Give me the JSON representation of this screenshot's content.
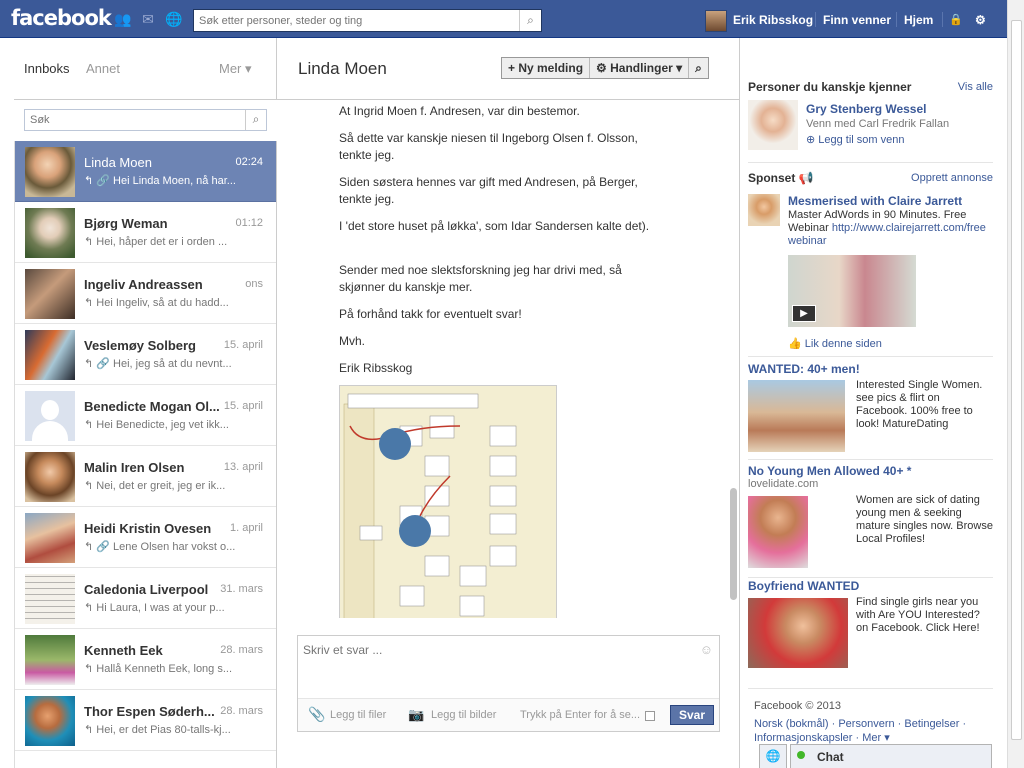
{
  "topbar": {
    "logo": "facebook",
    "search_placeholder": "Søk etter personer, steder og ting",
    "user_name": "Erik Ribsskog",
    "find_friends": "Finn venner",
    "home": "Hjem"
  },
  "inbox": {
    "tab_inbox": "Innboks",
    "tab_other": "Annet",
    "tab_more": "Mer ▾",
    "search_placeholder": "Søk",
    "threads": [
      {
        "name": "Linda Moen",
        "time": "02:24",
        "snippet": "↰ 🔗 Hei Linda Moen, nå har..."
      },
      {
        "name": "Bjørg Weman",
        "time": "01:12",
        "snippet": "↰ Hei, håper det er i orden ..."
      },
      {
        "name": "Ingeliv Andreassen",
        "time": "ons",
        "snippet": "↰ Hei Ingeliv, så at du hadd..."
      },
      {
        "name": "Veslemøy Solberg",
        "time": "15. april",
        "snippet": "↰ 🔗 Hei, jeg så at du nevnt..."
      },
      {
        "name": "Benedicte Mogan Ol...",
        "time": "15. april",
        "snippet": "↰ Hei Benedicte, jeg vet ikk..."
      },
      {
        "name": "Malin Iren Olsen",
        "time": "13. april",
        "snippet": "↰ Nei, det er greit, jeg er ik..."
      },
      {
        "name": "Heidi Kristin Ovesen",
        "time": "1. april",
        "snippet": "↰ 🔗 Lene Olsen har vokst o..."
      },
      {
        "name": "Caledonia Liverpool",
        "time": "31. mars",
        "snippet": "↰ Hi Laura, I was at your p..."
      },
      {
        "name": "Kenneth Eek",
        "time": "28. mars",
        "snippet": "↰ Hallå Kenneth Eek, long s..."
      },
      {
        "name": "Thor Espen Søderh...",
        "time": "28. mars",
        "snippet": "↰ Hei, er det Pias 80-talls-kj..."
      }
    ]
  },
  "conversation": {
    "title": "Linda Moen",
    "new_message": "+ Ny melding",
    "actions": "⚙ Handlinger ▾",
    "messages": [
      "At Ingrid Moen f. Andresen, var din bestemor.",
      "Så dette var kanskje niesen til Ingeborg Olsen f. Olsson, tenkte jeg.",
      "Siden søstera hennes var gift med Andresen, på Berger, tenkte jeg.",
      "I 'det store huset på løkka', som Idar Sandersen kalte det).",
      "Sender med noe slektsforskning jeg har drivi med, så skjønner du kanskje mer.",
      "På forhånd takk for eventuelt svar!",
      "Mvh.",
      "Erik Ribsskog"
    ],
    "reply_placeholder": "Skriv et svar ...",
    "attach_files": "Legg til filer",
    "attach_photos": "Legg til bilder",
    "enter_to_send": "Trykk på Enter for å se...",
    "send": "Svar"
  },
  "sidebar": {
    "pymk_title": "Personer du kanskje kjenner",
    "see_all": "Vis alle",
    "pymk_name": "Gry Stenberg Wessel",
    "pymk_mutual": "Venn med Carl Fredrik Fallan",
    "pymk_add": "Legg til som venn",
    "sponsored": "Sponset",
    "create_ad": "Opprett annonse",
    "ads": [
      {
        "title": "Mesmerised with Claire Jarrett",
        "text": "Master AdWords in 90 Minutes. Free Webinar",
        "link": "http://www.clairejarrett.com/freewebinar",
        "like": "Lik denne siden"
      },
      {
        "title": "WANTED: 40+ men!",
        "text": "Interested Single Women. see pics & flirt on Facebook. 100% free to look! MatureDating"
      },
      {
        "title": "No Young Men Allowed 40+ *",
        "domain": "lovelidate.com",
        "text": "Women are sick of dating young men & seeking mature singles now. Browse Local Profiles!"
      },
      {
        "title": "Boyfriend WANTED",
        "text": "Find single girls near you with Are YOU Interested? on Facebook. Click Here!"
      }
    ],
    "copyright": "Facebook © 2013",
    "footer_links": "Norsk (bokmål) · Personvern · Betingelser · Informasjonskapsler · Mer ▾",
    "chat": "Chat"
  },
  "colors": {
    "brand": "#3b5998",
    "selected_row": "#6d84b4"
  }
}
